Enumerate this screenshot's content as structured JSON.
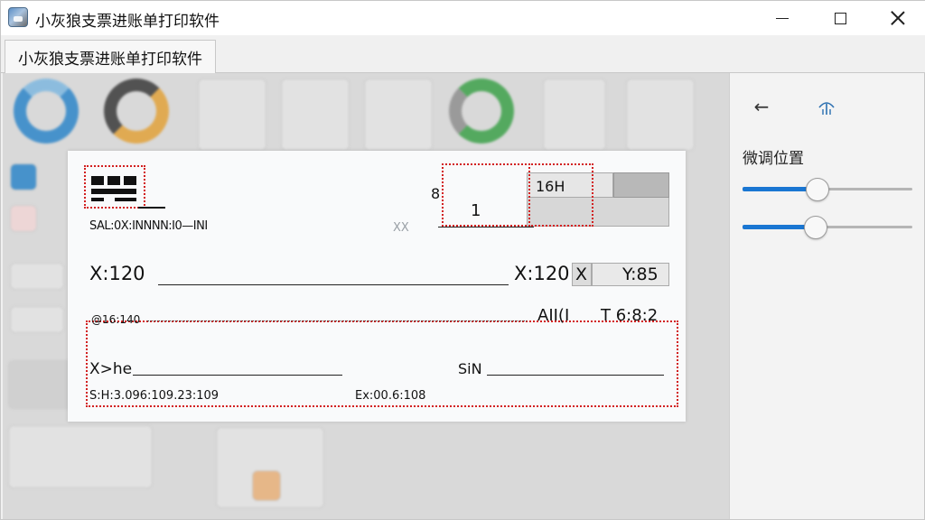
{
  "window": {
    "title": "小灰狼支票进账单打印软件"
  },
  "tabs": [
    {
      "label": "小灰狼支票进账单打印软件"
    }
  ],
  "cheque": {
    "top_left_code": "SAL:0X:INNNN:I0—INI",
    "top_right_digit": "8",
    "x_mark": "XX",
    "number_1": "1",
    "box_label": "16H",
    "x_label_1": "X:120",
    "x_label_2": "X:120",
    "x_label_3": "X",
    "y_label": "Y:85",
    "row3_left": "@16:140",
    "row3_mid": "AII(I",
    "row3_right": "T  6:8:2",
    "row4_left": "X>he",
    "row4_right": "SiN",
    "row5_left": "S:H:3.096:109.23:109",
    "row5_right": "Ex:00.6:108"
  },
  "right_panel": {
    "back_icon": "arrow-left-icon",
    "signal_icon": "antenna-icon",
    "title": "微调位置",
    "slider1_value": 0.44,
    "slider2_value": 0.43
  },
  "colors": {
    "accent": "#1976d2",
    "dotted_box": "#d21f1f"
  }
}
